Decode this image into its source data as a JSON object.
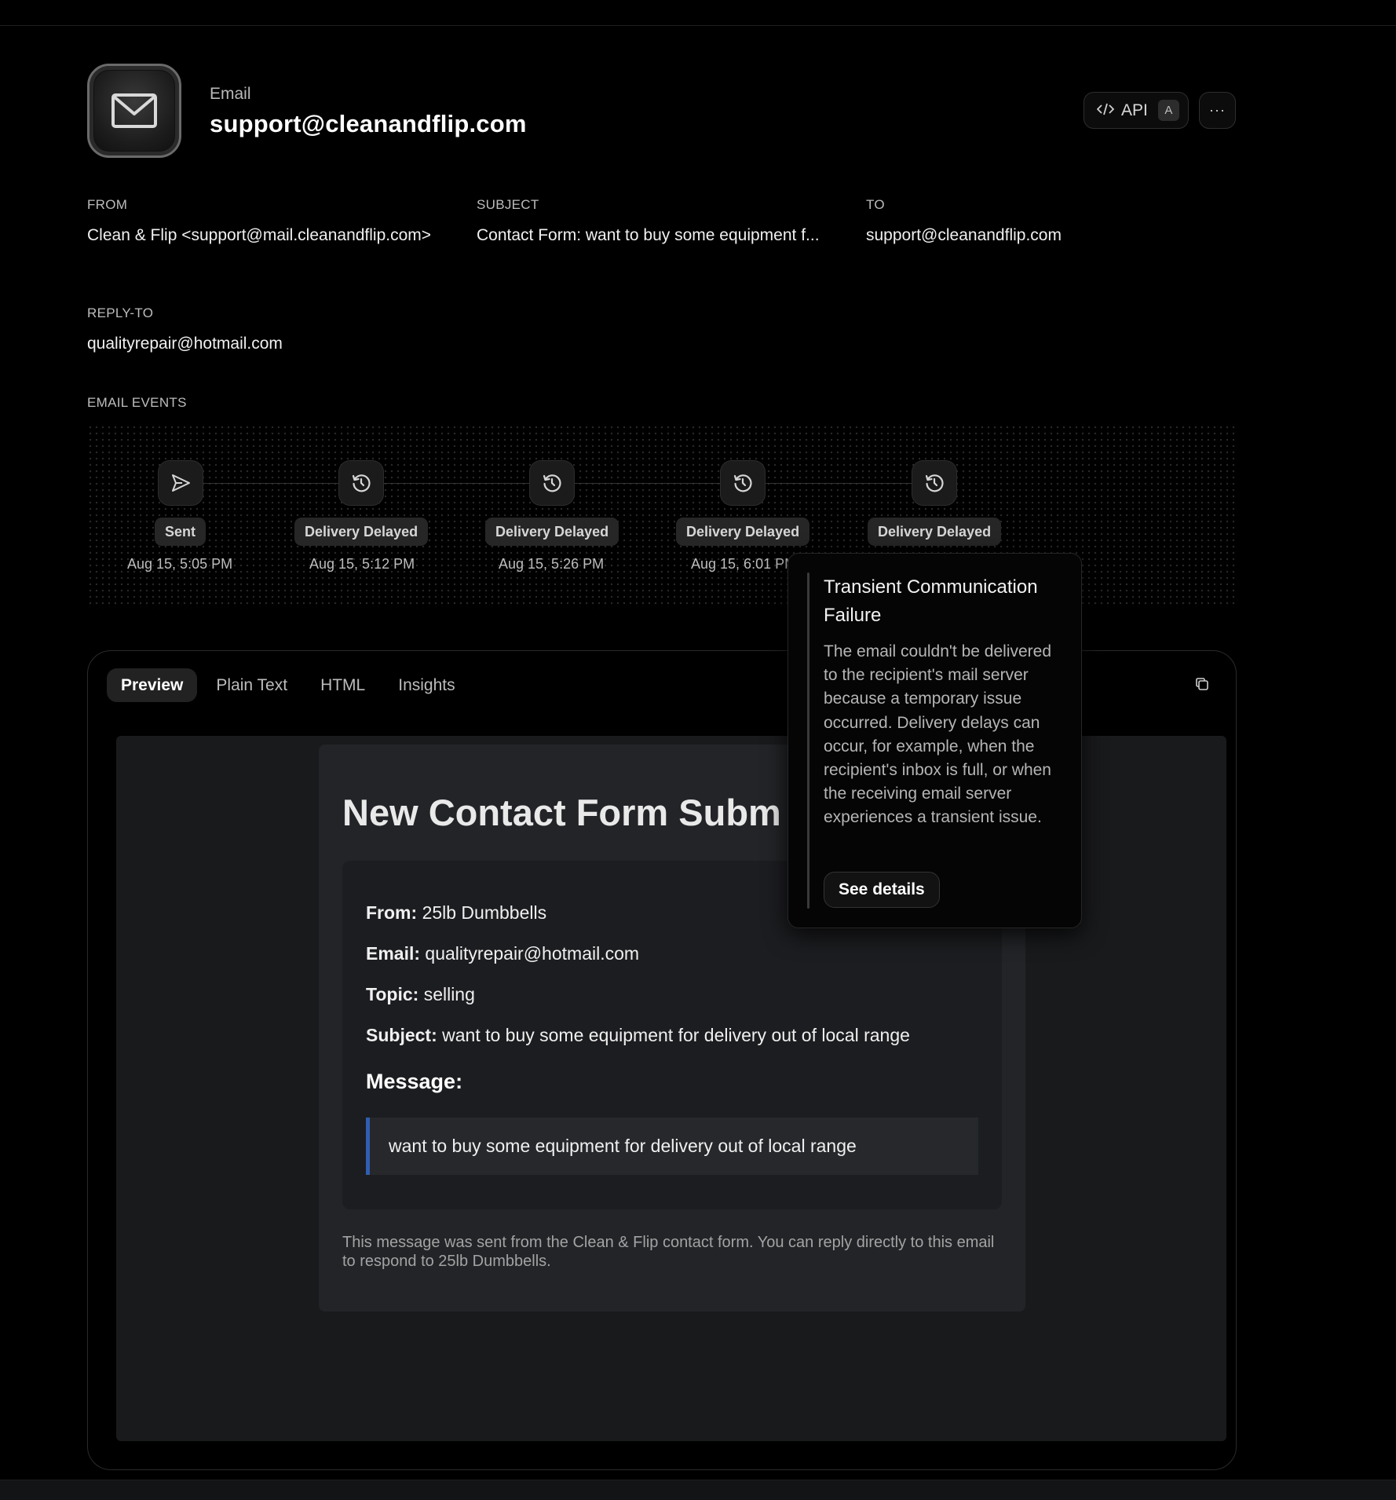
{
  "header": {
    "kicker": "Email",
    "title": "support@cleanandflip.com",
    "api_label": "API",
    "api_shortcut": "A",
    "more_label": "···",
    "icon": "mail-icon"
  },
  "fields": {
    "from_label": "FROM",
    "from_value": "Clean & Flip <support@mail.cleanandflip.com>",
    "subject_label": "SUBJECT",
    "subject_value": "Contact Form: want to buy some equipment f...",
    "to_label": "TO",
    "to_value": "support@cleanandflip.com",
    "reply_to_label": "REPLY-TO",
    "reply_to_value": "qualityrepair@hotmail.com"
  },
  "events": {
    "label": "EMAIL EVENTS",
    "items": [
      {
        "label": "Sent",
        "time": "Aug 15, 5:05 PM",
        "icon": "send-icon"
      },
      {
        "label": "Delivery Delayed",
        "time": "Aug 15, 5:12 PM",
        "icon": "history-icon"
      },
      {
        "label": "Delivery Delayed",
        "time": "Aug 15, 5:26 PM",
        "icon": "history-icon"
      },
      {
        "label": "Delivery Delayed",
        "time": "Aug 15, 6:01 PM",
        "icon": "history-icon"
      },
      {
        "label": "Delivery Delayed",
        "time": "",
        "icon": "history-icon"
      }
    ]
  },
  "tooltip": {
    "title": "Transient Communication Failure",
    "text": "The email couldn't be delivered to the recipient's mail server because a temporary issue occurred. Delivery delays can occur, for example, when the recipient's inbox is full, or when the receiving email server experiences a transient issue.",
    "button": "See details"
  },
  "tabs": [
    {
      "label": "Preview",
      "active": true
    },
    {
      "label": "Plain Text",
      "active": false
    },
    {
      "label": "HTML",
      "active": false
    },
    {
      "label": "Insights",
      "active": false
    }
  ],
  "copy_icon": "copy-icon",
  "preview": {
    "heading": "New Contact Form Subm",
    "from_key": "From:",
    "from_val": "25lb Dumbbells",
    "email_key": "Email:",
    "email_val": "qualityrepair@hotmail.com",
    "topic_key": "Topic:",
    "topic_val": "selling",
    "subject_key": "Subject:",
    "subject_val": "want to buy some equipment for delivery out of local range",
    "message_label": "Message:",
    "message": "want to buy some equipment for delivery out of local range",
    "footer": "This message was sent from the Clean & Flip contact form. You can reply directly to this email to respond to 25lb Dumbbells."
  }
}
